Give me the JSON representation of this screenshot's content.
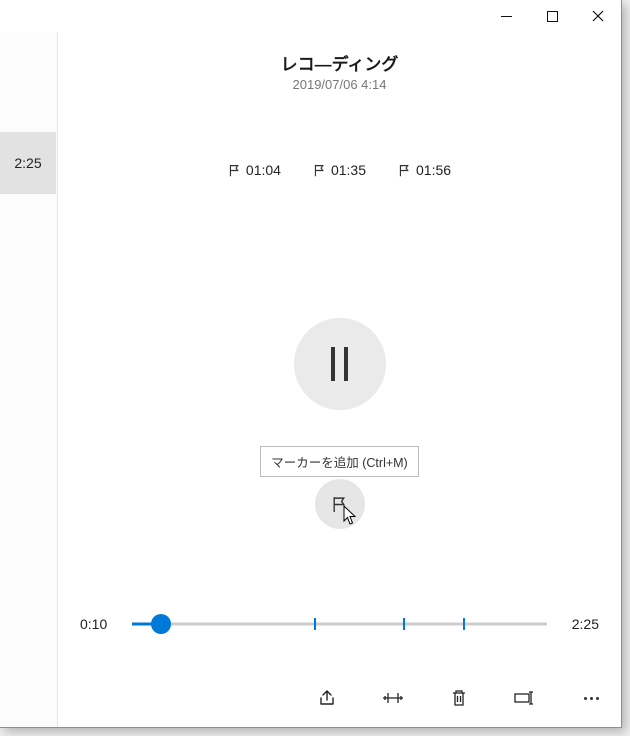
{
  "recording": {
    "title": "レコ―ディング",
    "datetime": "2019/07/06 4:14"
  },
  "sidebar": {
    "item_duration": "2:25"
  },
  "markers": [
    "01:04",
    "01:35",
    "01:56"
  ],
  "tooltip": {
    "text": "マーカーを追加 (Ctrl+M)"
  },
  "playback": {
    "current": "0:10",
    "total": "2:25",
    "progress_percent": 6.9,
    "marker_ticks_percent": [
      44.1,
      65.5,
      80.0
    ]
  }
}
